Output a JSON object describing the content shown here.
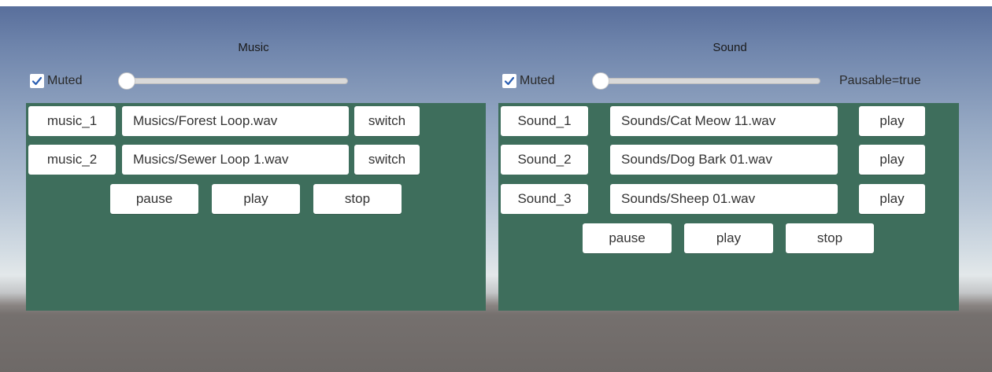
{
  "music": {
    "title": "Music",
    "muted": {
      "label": "Muted",
      "checked": true
    },
    "volume": 0,
    "rows": [
      {
        "name": "music_1",
        "path": "Musics/Forest Loop.wav",
        "action": "switch"
      },
      {
        "name": "music_2",
        "path": "Musics/Sewer Loop 1.wav",
        "action": "switch"
      }
    ],
    "controls": {
      "pause": "pause",
      "play": "play",
      "stop": "stop"
    }
  },
  "sound": {
    "title": "Sound",
    "muted": {
      "label": "Muted",
      "checked": true
    },
    "volume": 0,
    "pausable_text": "Pausable=true",
    "rows": [
      {
        "name": "Sound_1",
        "path": "Sounds/Cat Meow 11.wav",
        "action": "play"
      },
      {
        "name": "Sound_2",
        "path": "Sounds/Dog Bark 01.wav",
        "action": "play"
      },
      {
        "name": "Sound_3",
        "path": "Sounds/Sheep 01.wav",
        "action": "play"
      }
    ],
    "controls": {
      "pause": "pause",
      "play": "play",
      "stop": "stop"
    }
  },
  "colors": {
    "panel": "#3e6e5c",
    "button": "#ffffff",
    "checkmark": "#2b5fb3"
  },
  "icons": {
    "checkbox": "checkmark-icon"
  }
}
